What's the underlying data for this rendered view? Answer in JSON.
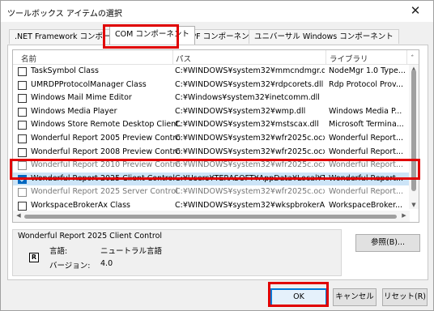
{
  "dialog": {
    "title": "ツールボックス アイテムの選択",
    "close": "✕"
  },
  "tabs": [
    ".NET Framework コンポーネント",
    "COM コンポーネント",
    "WPF コンポーネント",
    "ユニバーサル Windows コンポーネント"
  ],
  "active_tab": 1,
  "columns": [
    "名前",
    "パス",
    "ライブラリ",
    "ﾞ"
  ],
  "rows": [
    {
      "name": "TaskSymbol Class",
      "path": "C:¥WINDOWS¥system32¥mmcndmgr.dll",
      "library": "NodeMgr 1.0 Type...",
      "extra": "2",
      "checked": false
    },
    {
      "name": "UMRDPProtocolManager Class",
      "path": "C:¥WINDOWS¥system32¥rdpcorets.dll",
      "library": "Rdp Protocol Prov...",
      "extra": "2",
      "checked": false
    },
    {
      "name": "Windows Mail Mime Editor",
      "path": "C:¥Windows¥system32¥inetcomm.dll",
      "library": "",
      "extra": "2",
      "checked": false
    },
    {
      "name": "Windows Media Player",
      "path": "C:¥WINDOWS¥system32¥wmp.dll",
      "library": "Windows Media P...",
      "extra": "2",
      "checked": false
    },
    {
      "name": "Windows Store Remote Desktop Client...",
      "path": "C:¥WINDOWS¥system32¥mstscax.dll",
      "library": "Microsoft Termina...",
      "extra": "2",
      "checked": false
    },
    {
      "name": "Wonderful Report 2005 Preview Control",
      "path": "C:¥WINDOWS¥system32¥wfr2025c.ocx",
      "library": "Wonderful Report...",
      "extra": "2",
      "checked": false
    },
    {
      "name": "Wonderful Report 2008 Preview Control",
      "path": "C:¥WINDOWS¥system32¥wfr2025c.ocx",
      "library": "Wonderful Report...",
      "extra": "2",
      "checked": false
    },
    {
      "name": "Wonderful Report 2010 Preview Control",
      "path": "C:¥WINDOWS¥system32¥wfr2025c.ocx",
      "library": "Wonderful Report...",
      "extra": "2",
      "checked": false,
      "ghost": true
    },
    {
      "name": "Wonderful Report 2025 Client Control",
      "path": "C:¥Users¥TERASOFT¥AppData¥Local¥TER...",
      "library": "Wonderful Report...",
      "extra": "2",
      "checked": true,
      "selected": true
    },
    {
      "name": "Wonderful Report 2025 Server Control",
      "path": "C:¥WINDOWS¥system32¥wfr2025c.ocx",
      "library": "Wonderful Report...",
      "extra": "2",
      "checked": false,
      "ghost": true
    },
    {
      "name": "WorkspaceBrokerAx Class",
      "path": "C:¥WINDOWS¥system32¥wkspbrokerAx.dll",
      "library": "WorkspaceBroker...",
      "extra": "2",
      "checked": false
    }
  ],
  "info": {
    "title": "Wonderful Report 2025 Client Control",
    "icon_letter": "R",
    "language_label": "言語:",
    "language_value": "ニュートラル言語",
    "version_label": "バージョン:",
    "version_value": "4.0"
  },
  "buttons": {
    "browse": "参照(B)...",
    "ok": "OK",
    "cancel": "キャンセル",
    "reset": "リセット(R)"
  },
  "highlight_color": "#e00000",
  "accent_color": "#0078d7"
}
